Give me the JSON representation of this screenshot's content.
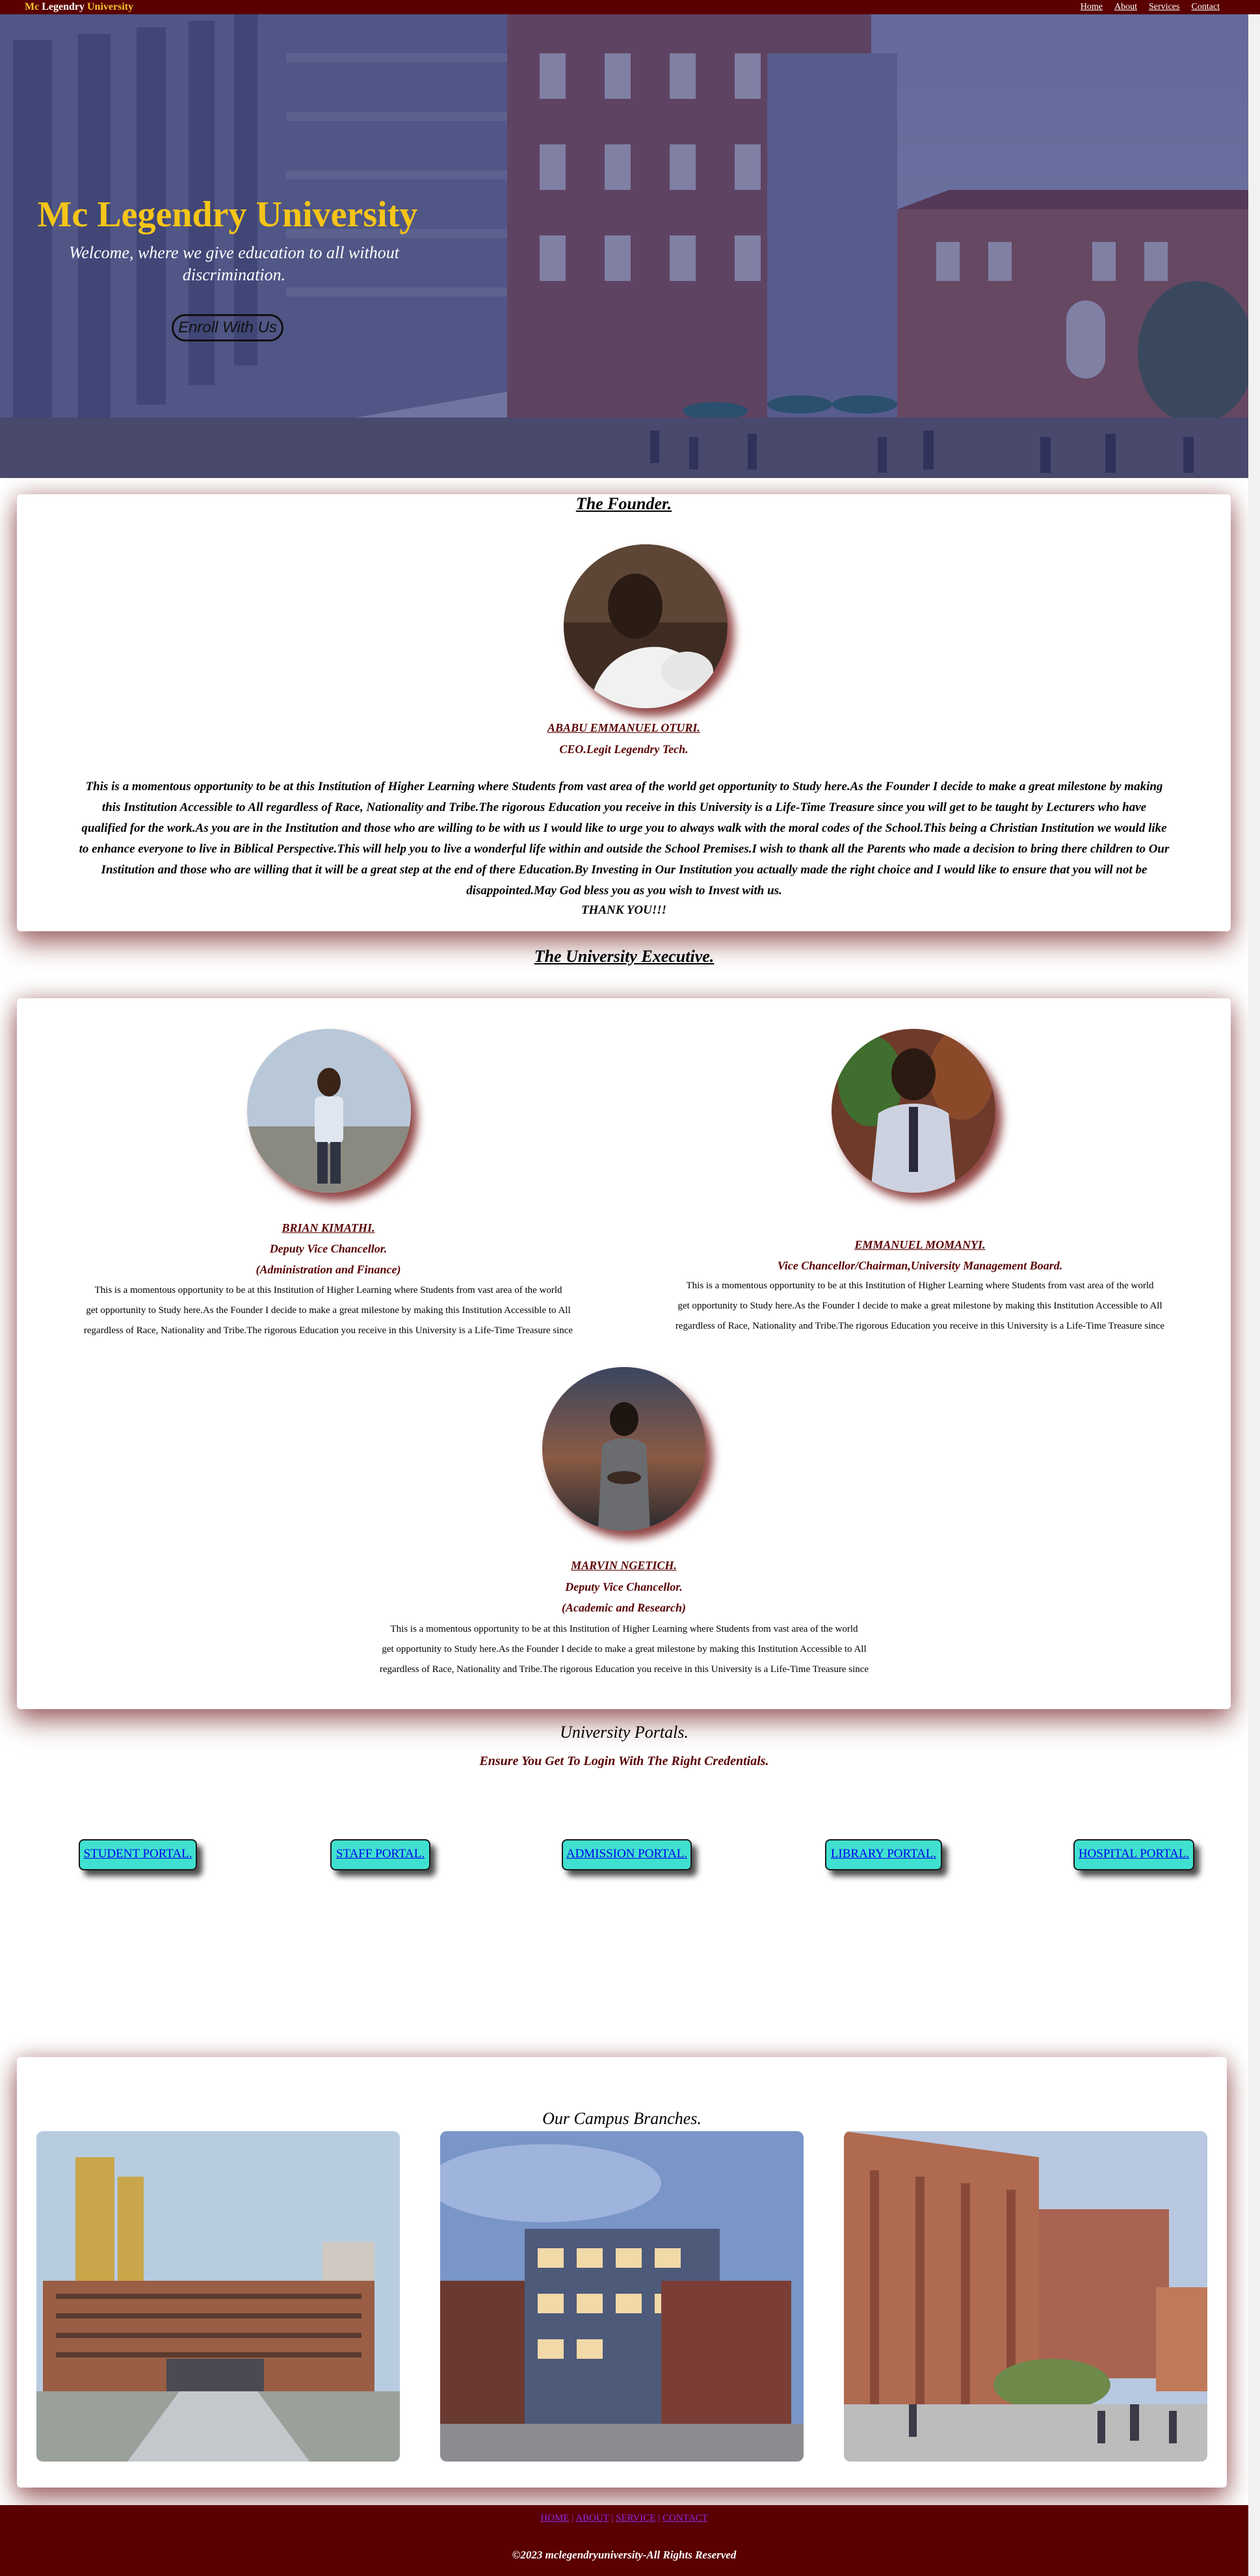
{
  "topbar": {
    "brand_part1": "Mc ",
    "brand_part2": "Legendry ",
    "brand_part3": "University",
    "nav": [
      "Home",
      "About",
      "Services",
      "Contact"
    ]
  },
  "hero": {
    "title": "Mc Legendry University",
    "subtitle": "Welcome, where we give education to all without discrimination.",
    "enroll_button": "Enroll With Us"
  },
  "founder": {
    "heading": "The Founder.",
    "name": "ABABU EMMANUEL OTURI.",
    "role": "CEO.Legit Legendry Tech.",
    "message": "This is a momentous opportunity to be at this Institution of Higher Learning where Students from vast area of the world get opportunity to Study here.As the Founder I decide to make a great milestone by making this Institution Accessible to All regardless of Race, Nationality and Tribe.The rigorous Education you receive in this University is a Life-Time Treasure since you will get to be taught by Lecturers who have qualified for the work.As you are in the Institution and those who are willing to be with us I would like to urge you to always walk with the moral codes of the School.This being a Christian Institution we would like to enhance everyone to live in Biblical Perspective.This will help you to live a wonderful life within and outside the School Premises.I wish to thank all the Parents who made a decision to bring there children to Our Institution and those who are willing that it will be a great step at the end of there Education.By Investing in Our Institution you actually made the right choice and I would like to ensure that you will not be disappointed.May God bless you as you wish to Invest with us.",
    "thanks": "THANK YOU!!!"
  },
  "executive": {
    "heading": "The University Executive.",
    "bio_line1": "This is a momentous opportunity to be at this Institution of Higher Learning where Students from vast area of the world",
    "bio_line2": "get opportunity to Study here.As the Founder I decide to make a great milestone by making this Institution Accessible to All",
    "bio_line3": "regardless of Race, Nationality and Tribe.The rigorous Education you receive in this University is a Life-Time Treasure since",
    "members": [
      {
        "name": "BRIAN KIMATHI.",
        "role1": "Deputy Vice Chancellor.",
        "role2": "(Administration and Finance)"
      },
      {
        "name": "EMMANUEL MOMANYI.",
        "role1": "Vice Chancellor/Chairman,University Management Board.",
        "role2": ""
      },
      {
        "name": "MARVIN NGETICH.",
        "role1": "Deputy Vice Chancellor.",
        "role2": "(Academic and Research)"
      }
    ]
  },
  "portals": {
    "title": "University Portals.",
    "subtitle": "Ensure You Get To Login With The Right Credentials.",
    "buttons": [
      "STUDENT PORTAL.",
      "STAFF PORTAL.",
      "ADMISSION PORTAL.",
      "LIBRARY PORTAL.",
      "HOSPITAL PORTAL."
    ]
  },
  "branches": {
    "title": "Our Campus Branches."
  },
  "footer": {
    "links": [
      "HOME",
      "ABOUT",
      "SERVICE",
      "CONTACT"
    ],
    "separator": " | ",
    "copyright": "©2023 mclegendryuniversity-All Rights Reserved"
  },
  "colors": {
    "maroon": "#5a0000",
    "gold": "#f5c518",
    "turquoise": "#40e0d0",
    "hero_overlay": "#2a2c69"
  }
}
